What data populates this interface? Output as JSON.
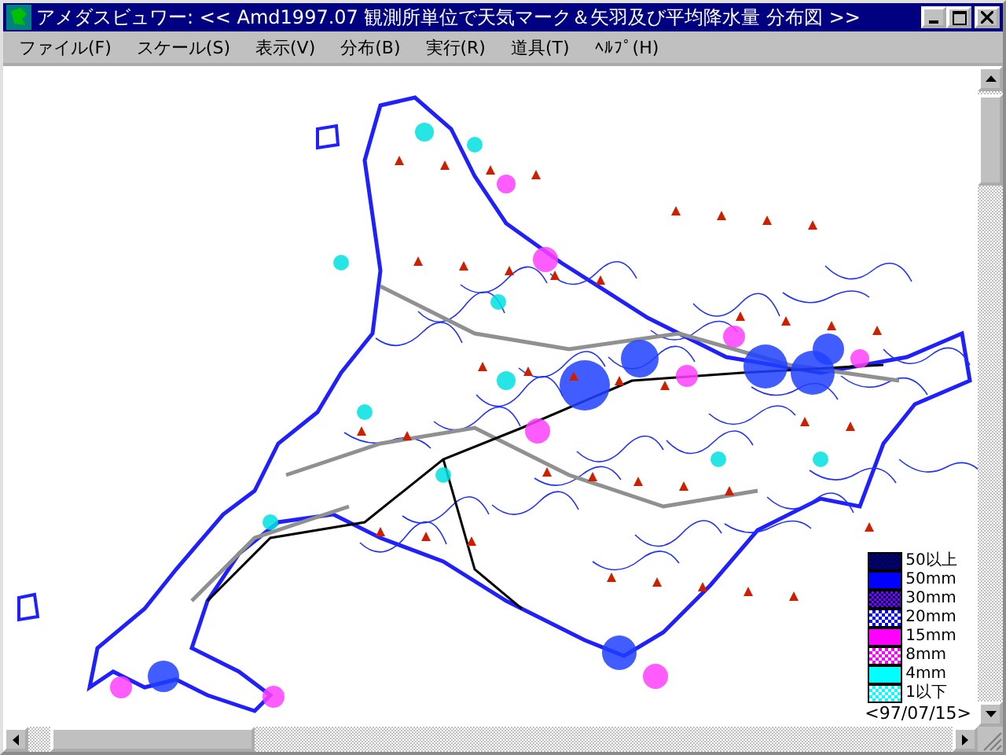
{
  "window": {
    "title": "アメダスビュワー: << Amd1997.07 観測所単位で天気マーク＆矢羽及び平均降水量 分布図 >>"
  },
  "menu": [
    {
      "label": "ファイル(F)"
    },
    {
      "label": "スケール(S)"
    },
    {
      "label": "表示(V)"
    },
    {
      "label": "分布(B)"
    },
    {
      "label": "実行(R)"
    },
    {
      "label": "道具(T)"
    },
    {
      "label": "ﾍﾙﾌﾟ(H)"
    }
  ],
  "legend": {
    "items": [
      {
        "label": "50以上",
        "color": "#000080",
        "kind": "dither"
      },
      {
        "label": "50mm",
        "color": "#0000ff",
        "kind": "solid"
      },
      {
        "label": "30mm",
        "color": "#8000ff",
        "kind": "dither"
      },
      {
        "label": "20mm",
        "color": "#0000ff",
        "kind": "checker"
      },
      {
        "label": "15mm",
        "color": "#ff00ff",
        "kind": "solid"
      },
      {
        "label": "8mm",
        "color": "#ff00ff",
        "kind": "checker"
      },
      {
        "label": "4mm",
        "color": "#00ffff",
        "kind": "solid"
      },
      {
        "label": "1以下",
        "color": "#00ffff",
        "kind": "checker"
      }
    ],
    "date": "<97/07/15>"
  }
}
